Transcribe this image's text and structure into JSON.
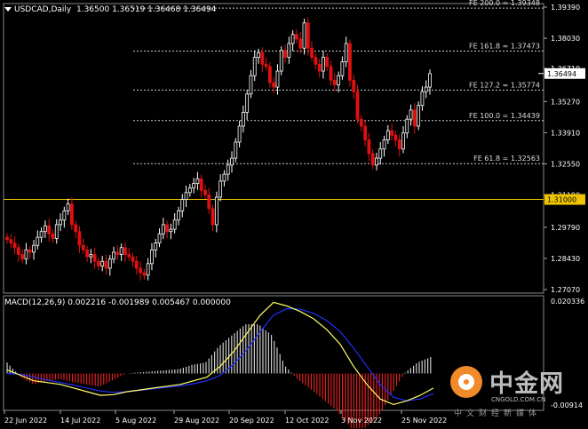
{
  "header": {
    "symbol": "USDCAD,Daily",
    "ohlc": "1.36500 1.36519 1.36468 1.36494"
  },
  "price_axis": {
    "ticks": [
      "1.39390",
      "1.38030",
      "1.36710",
      "1.35270",
      "1.33910",
      "1.32550",
      "1.31190",
      "1.29790",
      "1.28430",
      "1.27070"
    ],
    "current_price": "1.36494",
    "level_price": "1.31000"
  },
  "fib_levels": [
    {
      "label": "FE 200.0 = 1.39348",
      "value": 1.39348
    },
    {
      "label": "FE 161.8 = 1.37473",
      "value": 1.37473
    },
    {
      "label": "FE 127.2 = 1.35774",
      "value": 1.35774
    },
    {
      "label": "FE 100.0 = 1.34439",
      "value": 1.34439
    },
    {
      "label": "FE 61.8 = 1.32563",
      "value": 1.32563
    }
  ],
  "macd": {
    "header": "MACD(12,26,9) 0.002216 -0.001989 0.005467 0.000000",
    "axis_top": "0.020336",
    "axis_bottom": "-0.00914"
  },
  "date_axis": [
    "22 Jun 2022",
    "14 Jul 2022",
    "5 Aug 2022",
    "29 Aug 2022",
    "20 Sep 2022",
    "12 Oct 2022",
    "3 Nov 2022",
    "25 Nov 2022"
  ],
  "watermark": {
    "brand": "中金网",
    "url": "CNGOLD.COM.CN",
    "subtitle": "中文财经新媒体"
  },
  "colors": {
    "bull_candle": "#ffffff",
    "bear_candle": "#e01010",
    "fib_line": "#cccccc",
    "level_line": "#f0c400",
    "macd_main": "#ffff66",
    "macd_signal": "#2030ff",
    "hist_pos": "#cccccc",
    "hist_neg": "#e02020"
  },
  "chart_data": {
    "type": "candlestick",
    "symbol": "USDCAD",
    "timeframe": "Daily",
    "close_series": [
      1.2925,
      1.291,
      1.289,
      1.286,
      1.284,
      1.288,
      1.287,
      1.29,
      1.2935,
      1.296,
      1.2985,
      1.295,
      1.293,
      1.299,
      1.301,
      1.305,
      1.308,
      1.299,
      1.296,
      1.29,
      1.288,
      1.285,
      1.286,
      1.283,
      1.281,
      1.283,
      1.28,
      1.284,
      1.287,
      1.286,
      1.289,
      1.286,
      1.285,
      1.283,
      1.28,
      1.278,
      1.277,
      1.282,
      1.288,
      1.291,
      1.295,
      1.299,
      1.296,
      1.297,
      1.301,
      1.305,
      1.31,
      1.313,
      1.315,
      1.317,
      1.319,
      1.314,
      1.312,
      1.306,
      1.299,
      1.311,
      1.318,
      1.321,
      1.325,
      1.328,
      1.335,
      1.342,
      1.348,
      1.356,
      1.364,
      1.372,
      1.374,
      1.369,
      1.368,
      1.361,
      1.359,
      1.366,
      1.375,
      1.372,
      1.378,
      1.382,
      1.38,
      1.376,
      1.387,
      1.376,
      1.372,
      1.369,
      1.366,
      1.372,
      1.368,
      1.362,
      1.36,
      1.364,
      1.37,
      1.378,
      1.362,
      1.357,
      1.345,
      1.342,
      1.336,
      1.33,
      1.325,
      1.328,
      1.332,
      1.336,
      1.34,
      1.338,
      1.336,
      1.332,
      1.339,
      1.345,
      1.349,
      1.342,
      1.351,
      1.357,
      1.359,
      1.3649
    ],
    "macd_main": [
      0.001,
      -0.0005,
      -0.002,
      -0.0025,
      -0.003,
      -0.004,
      -0.005,
      -0.006,
      -0.0058,
      -0.005,
      -0.0045,
      -0.004,
      -0.0035,
      -0.003,
      -0.002,
      -0.001,
      0.002,
      0.006,
      0.011,
      0.016,
      0.0195,
      0.0185,
      0.017,
      0.015,
      0.012,
      0.008,
      0.002,
      -0.003,
      -0.007,
      -0.0085,
      -0.0075,
      -0.006,
      -0.004
    ],
    "macd_signal": [
      0.0,
      -0.0002,
      -0.001,
      -0.0018,
      -0.0025,
      -0.0032,
      -0.004,
      -0.0048,
      -0.0052,
      -0.005,
      -0.0046,
      -0.0042,
      -0.0038,
      -0.0034,
      -0.0028,
      -0.002,
      -0.0005,
      0.0025,
      0.0065,
      0.0115,
      0.016,
      0.0178,
      0.0176,
      0.0165,
      0.0145,
      0.0115,
      0.007,
      0.002,
      -0.003,
      -0.0065,
      -0.0075,
      -0.007,
      -0.0055
    ],
    "macd_hist_sign": "mixed",
    "yrange": [
      1.2707,
      1.3939
    ]
  }
}
